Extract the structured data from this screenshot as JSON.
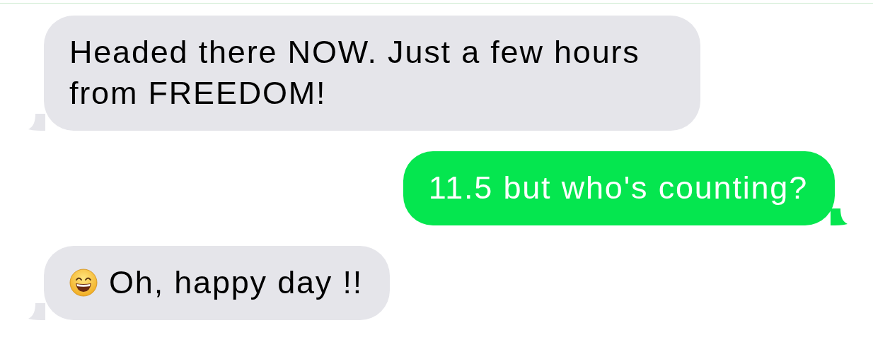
{
  "messages": [
    {
      "kind": "incoming",
      "text": "Headed there NOW. Just a few hours from FREEDOM!",
      "has_emoji": false
    },
    {
      "kind": "outgoing",
      "text": "11.5 but who's counting?",
      "has_emoji": false
    },
    {
      "kind": "incoming",
      "text": "Oh, happy day !!",
      "has_emoji": true
    }
  ]
}
